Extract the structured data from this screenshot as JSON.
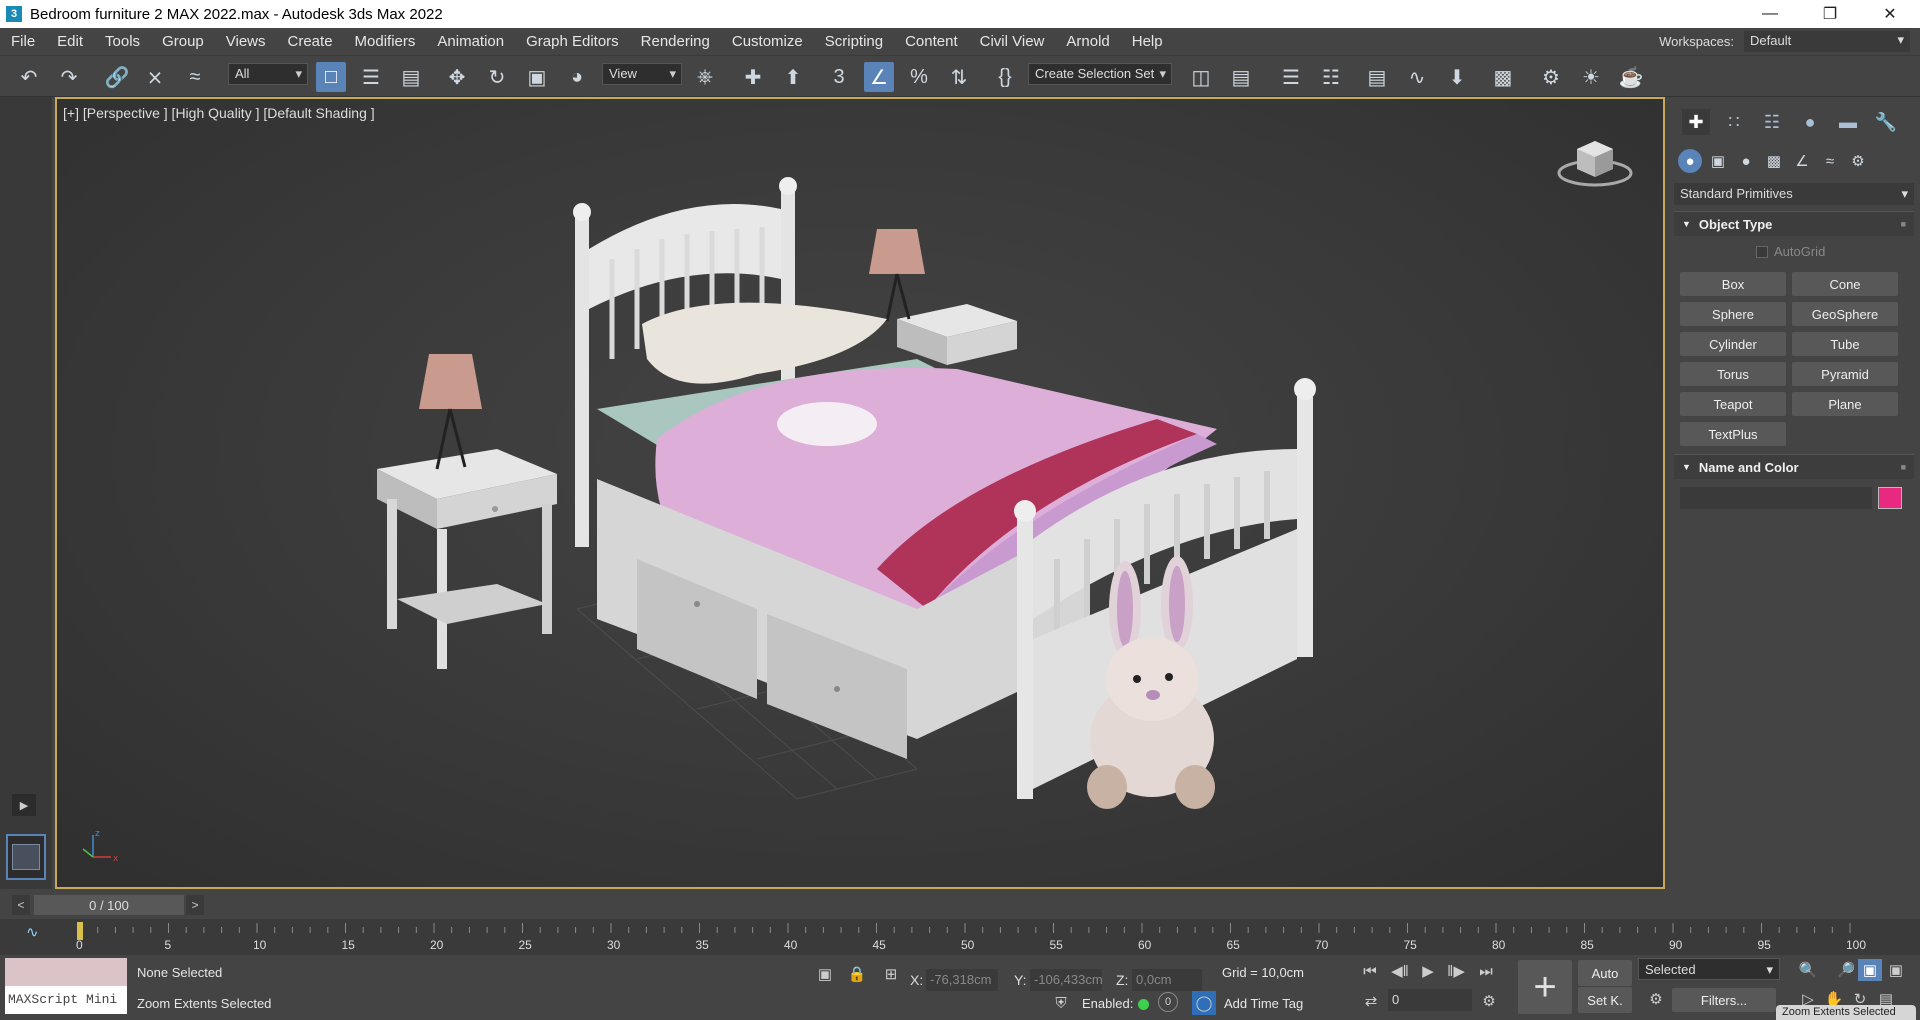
{
  "window": {
    "title": "Bedroom furniture 2 MAX 2022.max - Autodesk 3ds Max 2022",
    "app_icon": "3"
  },
  "menu": [
    "File",
    "Edit",
    "Tools",
    "Group",
    "Views",
    "Create",
    "Modifiers",
    "Animation",
    "Graph Editors",
    "Rendering",
    "Customize",
    "Scripting",
    "Content",
    "Civil View",
    "Arnold",
    "Help"
  ],
  "workspaces": {
    "label": "Workspaces:",
    "value": "Default"
  },
  "toolbar": {
    "filter": "All",
    "ref_coord": "View",
    "selection_set": "Create Selection Set"
  },
  "viewport": {
    "label": "[+] [Perspective ] [High Quality ] [Default Shading ]"
  },
  "command_panel": {
    "category": "Standard Primitives",
    "object_type": {
      "title": "Object Type",
      "autogrid": "AutoGrid",
      "buttons": [
        "Box",
        "Cone",
        "Sphere",
        "GeoSphere",
        "Cylinder",
        "Tube",
        "Torus",
        "Pyramid",
        "Teapot",
        "Plane",
        "TextPlus"
      ]
    },
    "name_color": {
      "title": "Name and Color",
      "color": "#e8297f"
    }
  },
  "time": {
    "slider": "0 / 100",
    "ticks": [
      "0",
      "5",
      "10",
      "15",
      "20",
      "25",
      "30",
      "35",
      "40",
      "45",
      "50",
      "55",
      "60",
      "65",
      "70",
      "75",
      "80",
      "85",
      "90",
      "95",
      "100"
    ]
  },
  "status": {
    "maxscript": "MAXScript Mini",
    "selection": "None Selected",
    "prompt": "Zoom Extents Selected",
    "x_label": "X:",
    "x": "-76,318cm",
    "y_label": "Y:",
    "y": "-106,433cm",
    "z_label": "Z:",
    "z": "0,0cm",
    "grid": "Grid = 10,0cm",
    "enabled": "Enabled:",
    "add_time_tag": "Add Time Tag",
    "frame": "0",
    "auto": "Auto",
    "setk": "Set K.",
    "selected": "Selected",
    "filters": "Filters...",
    "tooltip": "Zoom Extents Selected"
  }
}
